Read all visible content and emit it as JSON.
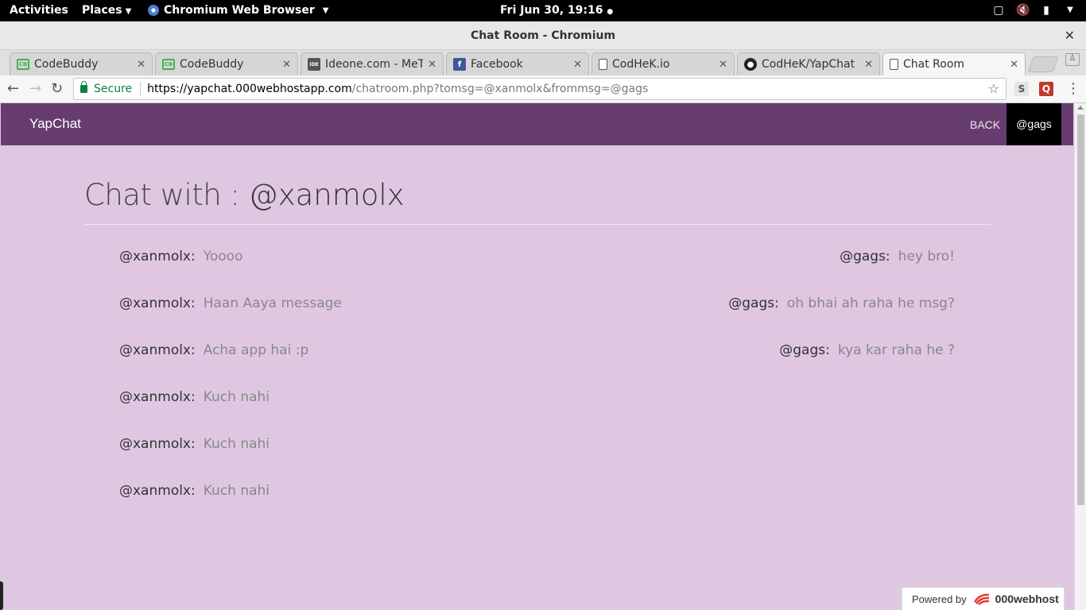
{
  "system_bar": {
    "activities": "Activities",
    "places": "Places",
    "app_name": "Chromium Web Browser",
    "clock": "Fri Jun 30, 19:16"
  },
  "window": {
    "title": "Chat Room - Chromium"
  },
  "tabs": [
    {
      "label": "CodeBuddy",
      "icon": "codebuddy-icon"
    },
    {
      "label": "CodeBuddy",
      "icon": "codebuddy-icon"
    },
    {
      "label": "Ideone.com - MeT",
      "icon": "ideone-icon"
    },
    {
      "label": "Facebook",
      "icon": "facebook-icon"
    },
    {
      "label": "CodHeK.io",
      "icon": "page-icon"
    },
    {
      "label": "CodHeK/YapChat",
      "icon": "github-icon"
    },
    {
      "label": "Chat Room",
      "icon": "page-icon",
      "active": true
    }
  ],
  "address_bar": {
    "secure_label": "Secure",
    "url_prefix": "https://yapchat.000webhostapp.com",
    "url_rest": "/chatroom.php?tomsg=@xanmolx&frommsg=@gags"
  },
  "app": {
    "brand": "YapChat",
    "back_label": "BACK",
    "current_user": "@gags",
    "heading_prefix": "Chat with : ",
    "heading_user": "@xanmolx"
  },
  "messages_left": [
    {
      "sender": "@xanmolx:",
      "text": "Yoooo"
    },
    {
      "sender": "@xanmolx:",
      "text": "Haan Aaya message"
    },
    {
      "sender": "@xanmolx:",
      "text": "Acha app hai :p"
    },
    {
      "sender": "@xanmolx:",
      "text": "Kuch nahi"
    },
    {
      "sender": "@xanmolx:",
      "text": "Kuch nahi"
    },
    {
      "sender": "@xanmolx:",
      "text": "Kuch nahi"
    }
  ],
  "messages_right": [
    {
      "sender": "@gags:",
      "text": "hey bro!"
    },
    {
      "sender": "@gags:",
      "text": "oh bhai ah raha he msg?"
    },
    {
      "sender": "@gags:",
      "text": "kya kar raha he ?"
    }
  ],
  "footer": {
    "powered_by": "Powered by",
    "host_name": "000webhost"
  },
  "colors": {
    "navbar": "#663d6e",
    "page_background": "#dfc7e2",
    "secure_green": "#0b8043"
  }
}
